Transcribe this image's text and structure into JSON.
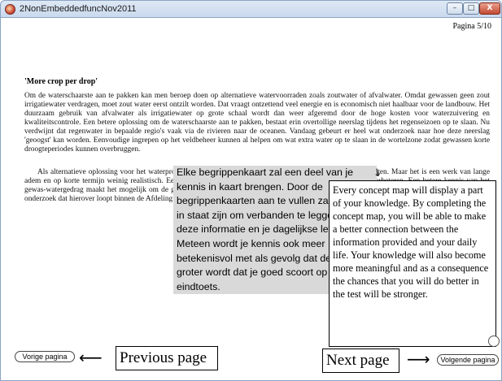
{
  "window": {
    "title": "2NonEmbeddedfuncNov2011",
    "minimize_glyph": "–",
    "maximize_glyph": "□",
    "close_glyph": "X"
  },
  "page": {
    "page_number": "Pagina 5/10",
    "heading": "'More crop per drop'",
    "paragraph1": "Om de waterschaarste aan te pakken kan men beroep doen op alternatieve watervoorraden zoals zoutwater of afvalwater. Omdat gewassen geen zout irrigatiewater verdragen, moet zout water eerst ontzilt worden. Dat vraagt ontzettend veel energie en is economisch niet haalbaar voor de landbouw. Het duurzaam gebruik van afvalwater als irrigatiewater op grote schaal wordt dan weer afgeremd door de hoge kosten voor waterzuivering en kwaliteitscontrole. Een betere oplossing om de waterschaarste aan te pakken, bestaat erin overtollige neerslag tijdens het regenseizoen op te slaan. Nu verdwijnt dat regenwater in bepaalde regio's vaak via de rivieren naar de oceanen. Vandaag gebeurt er heel wat onderzoek naar hoe deze neerslag 'geoogst' kan worden. Eenvoudige ingrepen op het veldbeheer kunnen al helpen om wat extra water op te slaan in de wortelzone zodat gewassen korte droogteperiodes kunnen overbruggen.",
    "paragraph2": "Als alternatieve oplossing voor het waterprobleem wordt gedacht aan het gebruik van tolerante gewasvariëteiten. Maar het is een werk van lange adem en op korte termijn weinig realistisch. Een andere strategie bestaat erin de gewas-waterproductiviteit te verbeteren. Een betere kennis van het gewas-watergedrag maakt het mogelijk om de gewasproductiviteit te verhogen. Op die manier ontstaat het concept 'more crop per drop' waaraan het onderzoek dat hierover loopt binnen de Afdeling Bodem- en Waterbeheer."
  },
  "dutch_tip": {
    "text": "Elke begrippenkaart zal een deel van je kennis in kaart brengen. Door de begrippenkaarten aan te vullen zal je beter in staat zijn om verbanden te leggen tussen deze informatie en je dagelijkse leven. Meteen wordt je kennis ook meer betekenisvol met als gevolg dat de kans groter wordt dat je goed scoort op de eindtoets."
  },
  "english_translation": {
    "text": "Every concept map will display a part of your knowledge. By completing the concept map, you will be able to make a better connection between the information provided and your daily life. Your knowledge will also become more meaningful and as a consequence the chances that you will do better in the test will be stronger."
  },
  "navigation": {
    "prev_button": "Vorige pagina",
    "next_button": "Volgende pagina",
    "prev_label": "Previous page",
    "next_label": "Next page",
    "arrow_left": "⟵",
    "arrow_right": "⟶",
    "arrow_small": "↘"
  }
}
